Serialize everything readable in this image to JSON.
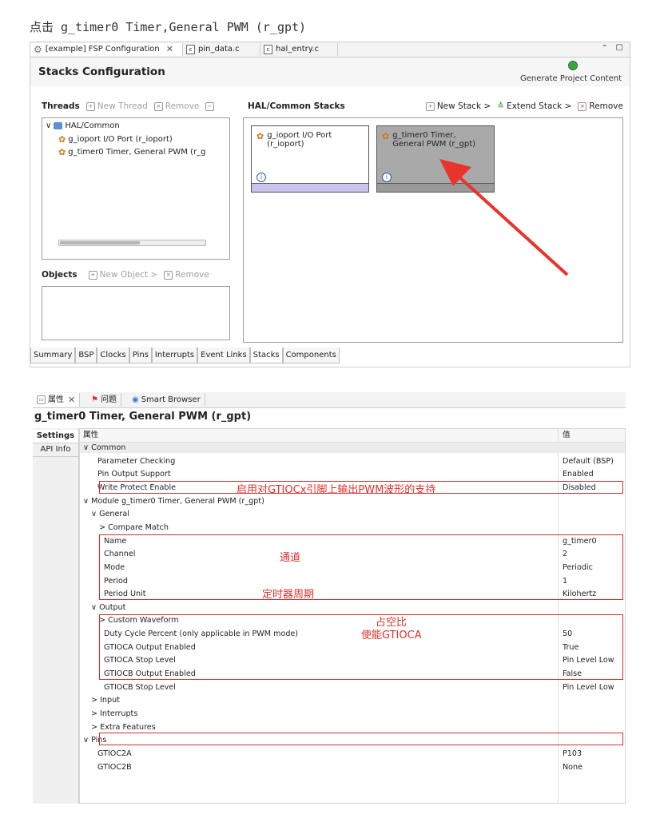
{
  "caption": "点击 g_timer0 Timer,General PWM (r_gpt)",
  "fsp": {
    "tabs": [
      "[example] FSP Configuration",
      "pin_data.c",
      "hal_entry.c"
    ],
    "window_controls": "⁼ ▢",
    "title": "Stacks Configuration",
    "generate_label": "Generate Project Content",
    "threads": {
      "title": "Threads",
      "new_thread": "New Thread",
      "remove": "Remove",
      "tree_root": "HAL/Common",
      "tree_items": [
        "g_ioport I/O Port (r_ioport)",
        "g_timer0 Timer, General PWM (r_g"
      ]
    },
    "objects": {
      "title": "Objects",
      "new_object": "New Object >",
      "remove": "Remove"
    },
    "stacks": {
      "title": "HAL/Common Stacks",
      "new_stack": "New Stack >",
      "extend_stack": "Extend Stack >",
      "remove": "Remove",
      "cards": [
        {
          "label": "g_ioport I/O Port (r_ioport)",
          "bar_color": "#c9c4ee",
          "bg": "#ffffff"
        },
        {
          "label": "g_timer0 Timer, General PWM (r_gpt)",
          "bar_color": "#9a9a9a",
          "bg": "#a9a9a9"
        }
      ]
    },
    "bottom_tabs": [
      "Summary",
      "BSP",
      "Clocks",
      "Pins",
      "Interrupts",
      "Event Links",
      "Stacks",
      "Components"
    ],
    "active_bottom_tab": "Stacks",
    "arrow_color": "#e8342c"
  },
  "props": {
    "tabs": [
      "属性",
      "问题",
      "Smart Browser"
    ],
    "title": "g_timer0 Timer, General PWM (r_gpt)",
    "side_tabs": [
      "Settings",
      "API Info"
    ],
    "col_property": "属性",
    "col_value": "值",
    "rows": [
      {
        "k": "∨ Common",
        "v": ""
      },
      {
        "k": "Parameter Checking",
        "v": "Default (BSP)"
      },
      {
        "k": "Pin Output Support",
        "v": "Enabled"
      },
      {
        "k": "Write Protect Enable",
        "v": "Disabled"
      },
      {
        "k": "∨ Module g_timer0 Timer, General PWM (r_gpt)",
        "v": ""
      },
      {
        "k": "∨ General",
        "v": ""
      },
      {
        "k": "> Compare Match",
        "v": ""
      },
      {
        "k": "Name",
        "v": "g_timer0"
      },
      {
        "k": "Channel",
        "v": "2"
      },
      {
        "k": "Mode",
        "v": "Periodic"
      },
      {
        "k": "Period",
        "v": "1"
      },
      {
        "k": "Period Unit",
        "v": "Kilohertz"
      },
      {
        "k": "∨ Output",
        "v": ""
      },
      {
        "k": "> Custom Waveform",
        "v": ""
      },
      {
        "k": "Duty Cycle Percent (only applicable in PWM mode)",
        "v": "50"
      },
      {
        "k": "GTIOCA Output Enabled",
        "v": "True"
      },
      {
        "k": "GTIOCA Stop Level",
        "v": "Pin Level Low"
      },
      {
        "k": "GTIOCB Output Enabled",
        "v": "False"
      },
      {
        "k": "GTIOCB Stop Level",
        "v": "Pin Level Low"
      },
      {
        "k": "> Input",
        "v": ""
      },
      {
        "k": "> Interrupts",
        "v": ""
      },
      {
        "k": "> Extra Features",
        "v": ""
      },
      {
        "k": "∨ Pins",
        "v": ""
      },
      {
        "k": "GTIOC2A",
        "v": "P103"
      },
      {
        "k": "GTIOC2B",
        "v": "None"
      }
    ],
    "annotations": {
      "pin_output": "启用对GTIOCx引脚上输出PWM波形的支持",
      "channel": "通道",
      "period": "定时器周期",
      "duty": "占空比",
      "gtioca": "使能GTIOCA"
    }
  }
}
